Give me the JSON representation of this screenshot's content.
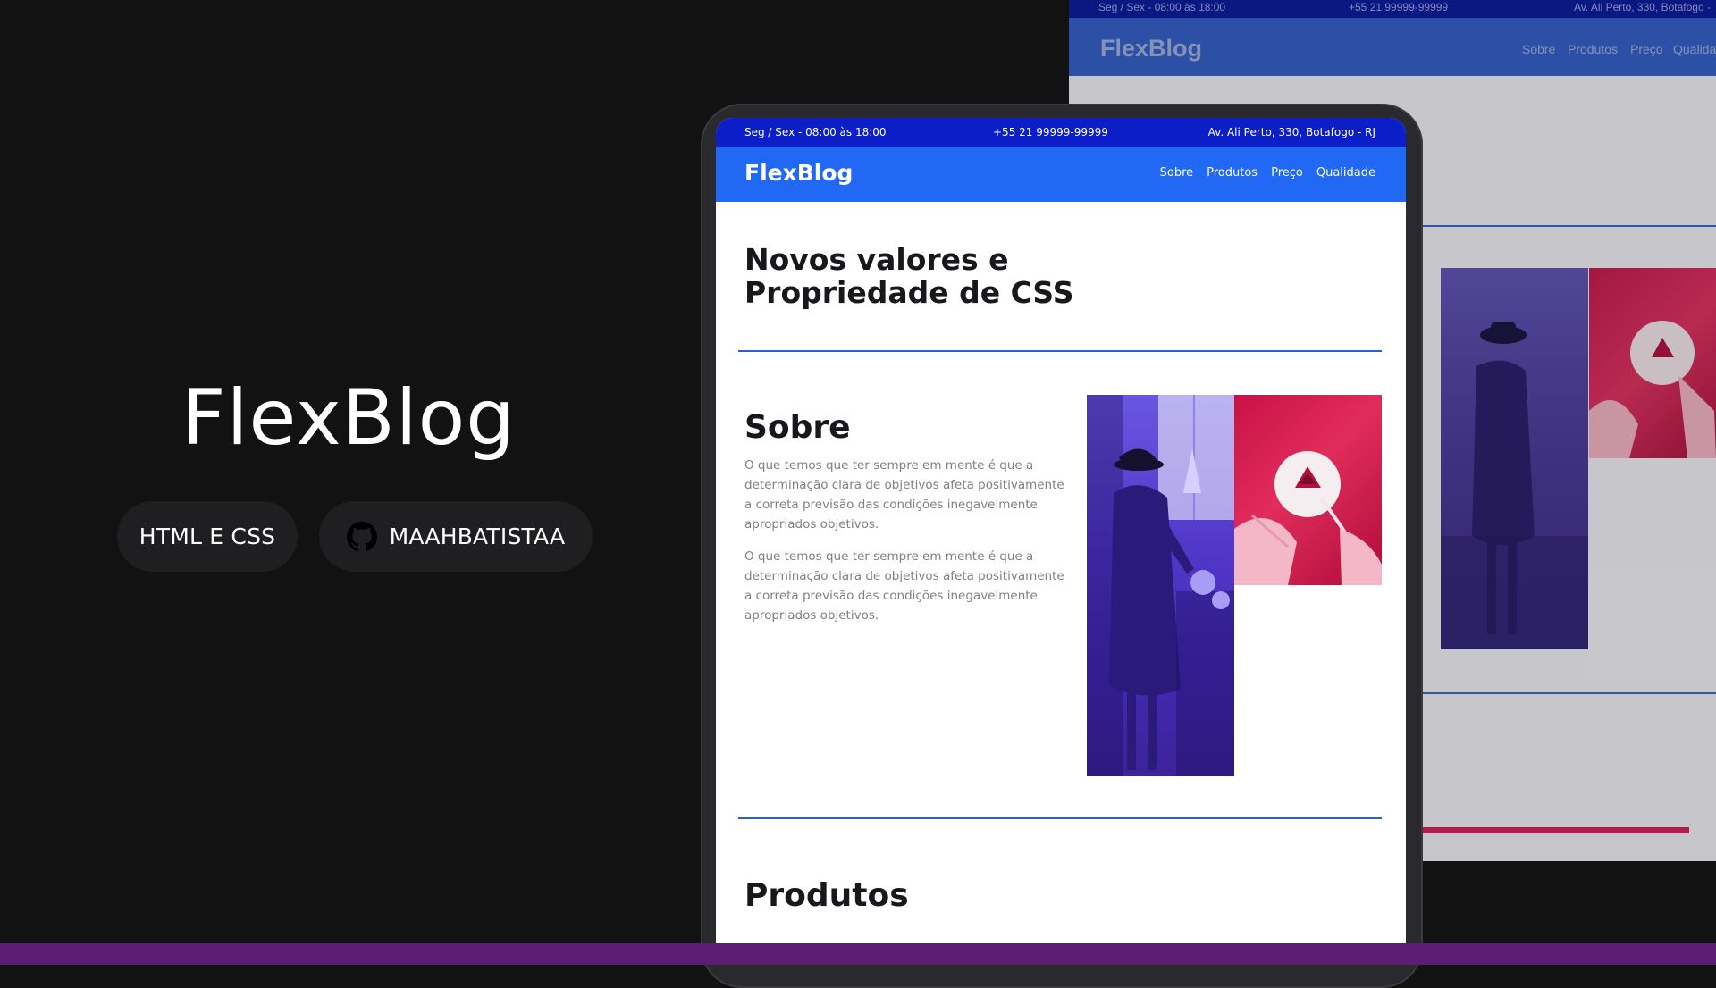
{
  "promo": {
    "title": "FlexBlog",
    "tech_pill": "HTML E CSS",
    "github_pill": "MAAHBATISTAA",
    "github_icon": "github-icon"
  },
  "site": {
    "topbar": {
      "hours": "Seg / Sex - 08:00 às 18:00",
      "phone": "+55 21 99999-99999",
      "address": "Av. Ali Perto, 330, Botafogo - RJ"
    },
    "logo": "FlexBlog",
    "nav": [
      "Sobre",
      "Produtos",
      "Preço",
      "Qualidade"
    ],
    "hero_title_line1": "Novos valores e",
    "hero_title_line2": "Propriedade de CSS",
    "sobre": {
      "heading": "Sobre",
      "paragraph1": "O que temos que ter sempre em mente é que a determinação clara de objetivos afeta positivamente a correta previsão das condições inegavelmente apropriados objetivos.",
      "paragraph2": "O que temos que ter sempre em mente é que a determinação clara de objetivos afeta positivamente a correta previsão das condições inegavelmente apropriados objetivos."
    },
    "produtos": {
      "heading": "Produtos"
    }
  },
  "background_site": {
    "topbar": {
      "hours": "Seg / Sex - 08:00 às 18:00",
      "phone": "+55 21 99999-99999",
      "address": "Av. Ali Perto, 330, Botafogo -"
    },
    "logo": "FlexBlog",
    "nav": [
      "Sobre",
      "Produtos",
      "Preço",
      "Qualida"
    ]
  },
  "colors": {
    "page_background": "#121212",
    "topbar": "#0b1ec8",
    "navbar": "#2168f5",
    "divider": "#2a5fd6",
    "bottom_bar": "#5d1d73",
    "accent_pink": "#d4245a"
  }
}
